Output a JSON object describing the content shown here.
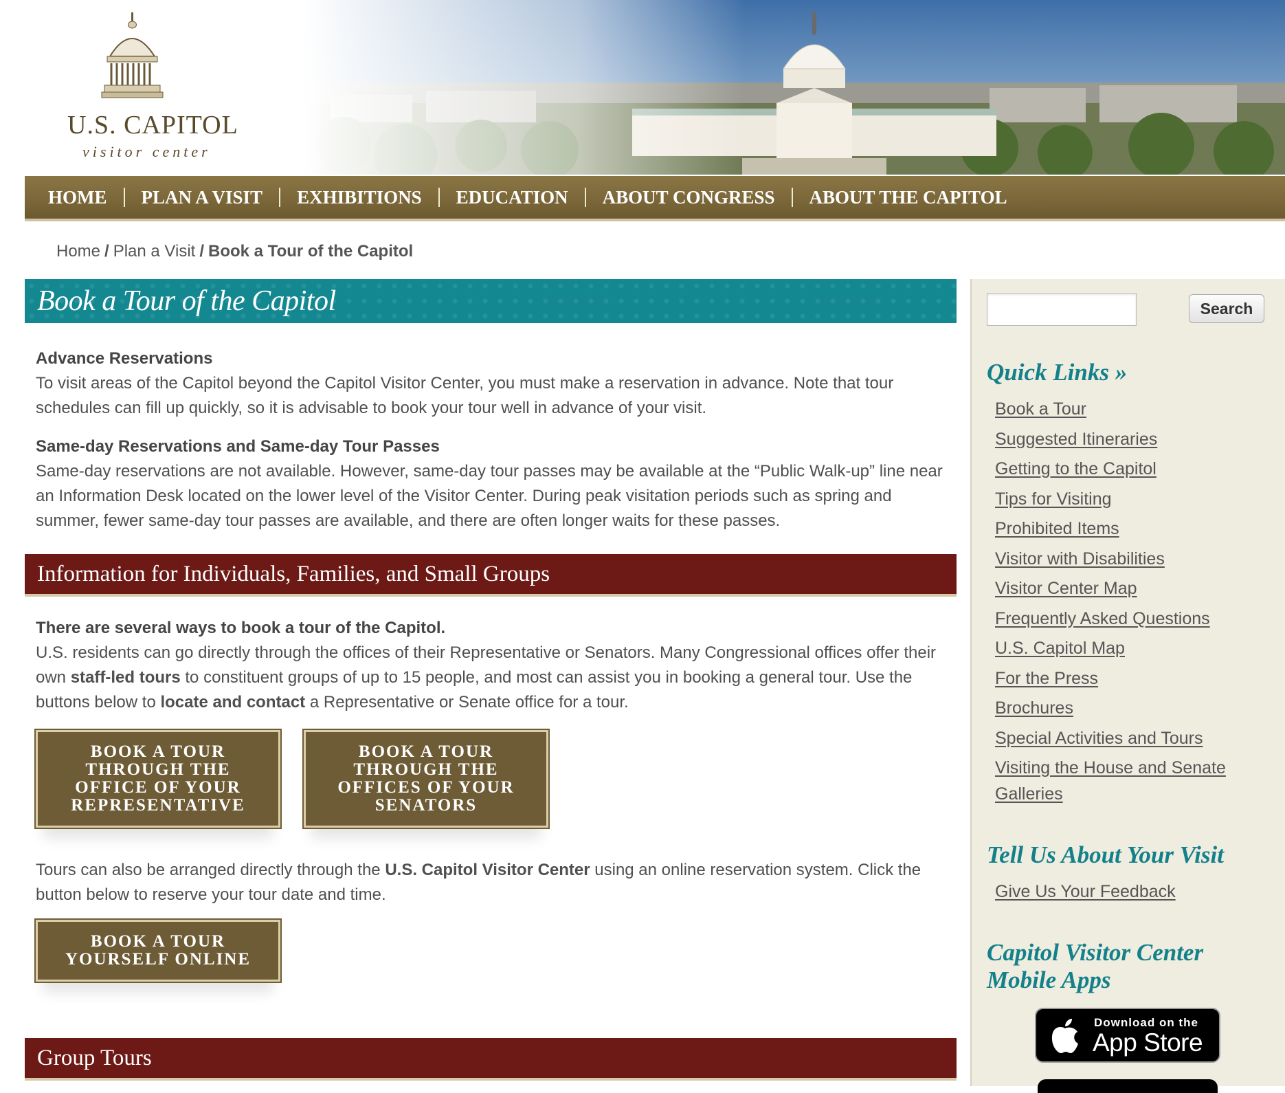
{
  "logo": {
    "title": "U.S. CAPITOL",
    "subtitle": "visitor center"
  },
  "nav": {
    "items": [
      "HOME",
      "PLAN A VISIT",
      "EXHIBITIONS",
      "EDUCATION",
      "ABOUT CONGRESS",
      "ABOUT THE CAPITOL"
    ]
  },
  "breadcrumb": {
    "home": "Home",
    "plan": "Plan a Visit",
    "current": "Book a Tour of the Capitol",
    "separator": "/"
  },
  "main": {
    "title": "Book a Tour of the Capitol",
    "advance": {
      "heading": "Advance Reservations",
      "text": "To visit areas of the Capitol beyond the Capitol Visitor Center, you must make a reservation in advance. Note that tour schedules can fill up quickly, so it is advisable to book your tour well in advance of your visit."
    },
    "sameday": {
      "heading": "Same-day Reservations and Same-day Tour Passes",
      "text": "Same-day reservations are not available. However, same-day tour passes may be available at the “Public Walk-up” line near an Information Desk located on the lower level of the Visitor Center. During peak visitation periods such as spring and summer, fewer same-day tour passes are available, and there are often longer waits for these passes."
    },
    "individuals": {
      "heading": "Information for Individuals, Families, and Small Groups",
      "intro": "There are several ways to book a tour of the Capitol.",
      "p1_a": "U.S. residents can go directly through the offices of their Representative or Senators. Many Congressional offices offer their own ",
      "p1_b": "staff-led tours",
      "p1_c": " to constituent groups of up to 15 people, and most can assist you in booking a general tour. Use the buttons below to ",
      "p1_d": "locate and contact",
      "p1_e": " a Representative or Senate office for a tour.",
      "btn_representative": "BOOK A TOUR\nTHROUGH THE\nOFFICE OF YOUR\nREPRESENTATIVE",
      "btn_senators": "BOOK A TOUR\nTHROUGH THE\nOFFICES OF YOUR\nSENATORS",
      "p2_a": "Tours can also be arranged directly through the ",
      "p2_b": "U.S. Capitol Visitor Center",
      "p2_c": " using an online reservation system.  Click the button below to reserve your tour date and time.",
      "btn_online": "BOOK A TOUR\nYOURSELF ONLINE"
    },
    "group": {
      "heading": "Group Tours"
    }
  },
  "sidebar": {
    "search": {
      "placeholder": "",
      "button": "Search"
    },
    "quick_links_heading": "Quick Links »",
    "quick_links": [
      "Book a Tour",
      "Suggested Itineraries",
      "Getting to the Capitol",
      "Tips for Visiting",
      "Prohibited Items",
      "Visitor with Disabilities",
      "Visitor Center Map",
      "Frequently Asked Questions",
      "U.S. Capitol Map",
      "For the Press",
      "Brochures",
      "Special Activities and Tours",
      "Visiting the House and Senate Galleries"
    ],
    "tell_us_heading": "Tell Us About Your Visit",
    "feedback_link": "Give Us Your Feedback",
    "apps_heading_1": "Capitol Visitor Center",
    "apps_heading_2": "Mobile Apps",
    "app_store": {
      "small": "Download on the",
      "big": "App Store"
    }
  },
  "colors": {
    "nav": "#7a6638",
    "teal": "#138891",
    "maroon": "#6d1a17",
    "button": "#6e5c36",
    "sidebar": "#efece0",
    "sidebar_heading": "#13808a"
  }
}
